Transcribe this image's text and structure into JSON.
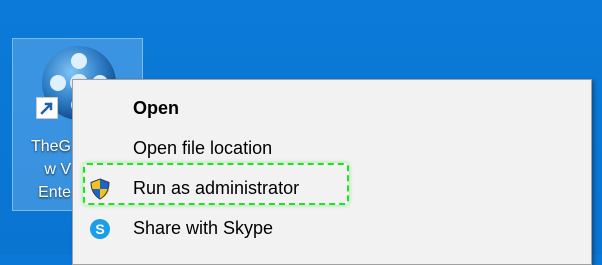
{
  "desktop": {
    "shortcut": {
      "label_lines": [
        "TheG",
        "w V",
        "Ente"
      ],
      "icon": "film-reel-icon",
      "overlay_icon": "shortcut-arrow-icon"
    }
  },
  "context_menu": {
    "items": [
      {
        "label": "Open",
        "icon": null,
        "bold": true
      },
      {
        "label": "Open file location",
        "icon": null,
        "bold": false
      },
      {
        "label": "Run as administrator",
        "icon": "uac-shield-icon",
        "bold": false
      },
      {
        "label": "Share with Skype",
        "icon": "skype-icon",
        "bold": false
      }
    ],
    "highlight_color": "#22e022"
  }
}
